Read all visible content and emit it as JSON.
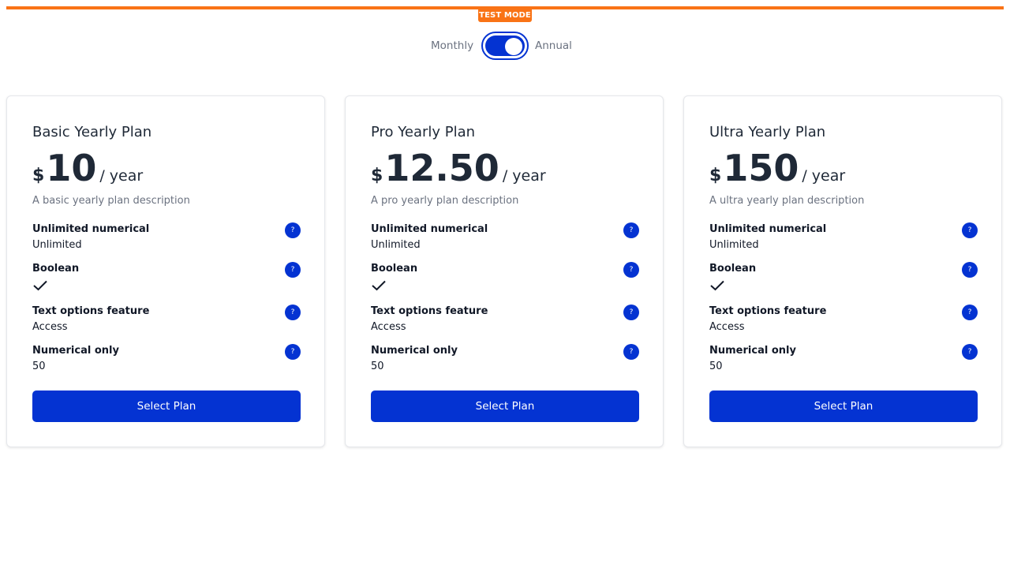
{
  "test_mode": {
    "label": "TEST MODE",
    "color": "#f97316"
  },
  "billing_toggle": {
    "monthly_label": "Monthly",
    "annual_label": "Annual",
    "selected": "Annual",
    "accent": "#0433d2"
  },
  "plans": [
    {
      "name": "Basic Yearly Plan",
      "currency": "$",
      "amount": "10",
      "period": "/ year",
      "description": "A basic yearly plan description",
      "features": [
        {
          "name": "Unlimited numerical",
          "value": "Unlimited",
          "help": "?"
        },
        {
          "name": "Boolean",
          "value": "",
          "check": true,
          "help": "?"
        },
        {
          "name": "Text options feature",
          "value": "Access",
          "help": "?"
        },
        {
          "name": "Numerical only",
          "value": "50",
          "help": "?"
        }
      ],
      "button_label": "Select Plan"
    },
    {
      "name": "Pro Yearly Plan",
      "currency": "$",
      "amount": "12.50",
      "period": "/ year",
      "description": "A pro yearly plan description",
      "features": [
        {
          "name": "Unlimited numerical",
          "value": "Unlimited",
          "help": "?"
        },
        {
          "name": "Boolean",
          "value": "",
          "check": true,
          "help": "?"
        },
        {
          "name": "Text options feature",
          "value": "Access",
          "help": "?"
        },
        {
          "name": "Numerical only",
          "value": "50",
          "help": "?"
        }
      ],
      "button_label": "Select Plan"
    },
    {
      "name": "Ultra Yearly Plan",
      "currency": "$",
      "amount": "150",
      "period": "/ year",
      "description": "A ultra yearly plan description",
      "features": [
        {
          "name": "Unlimited numerical",
          "value": "Unlimited",
          "help": "?"
        },
        {
          "name": "Boolean",
          "value": "",
          "check": true,
          "help": "?"
        },
        {
          "name": "Text options feature",
          "value": "Access",
          "help": "?"
        },
        {
          "name": "Numerical only",
          "value": "50",
          "help": "?"
        }
      ],
      "button_label": "Select Plan"
    }
  ]
}
